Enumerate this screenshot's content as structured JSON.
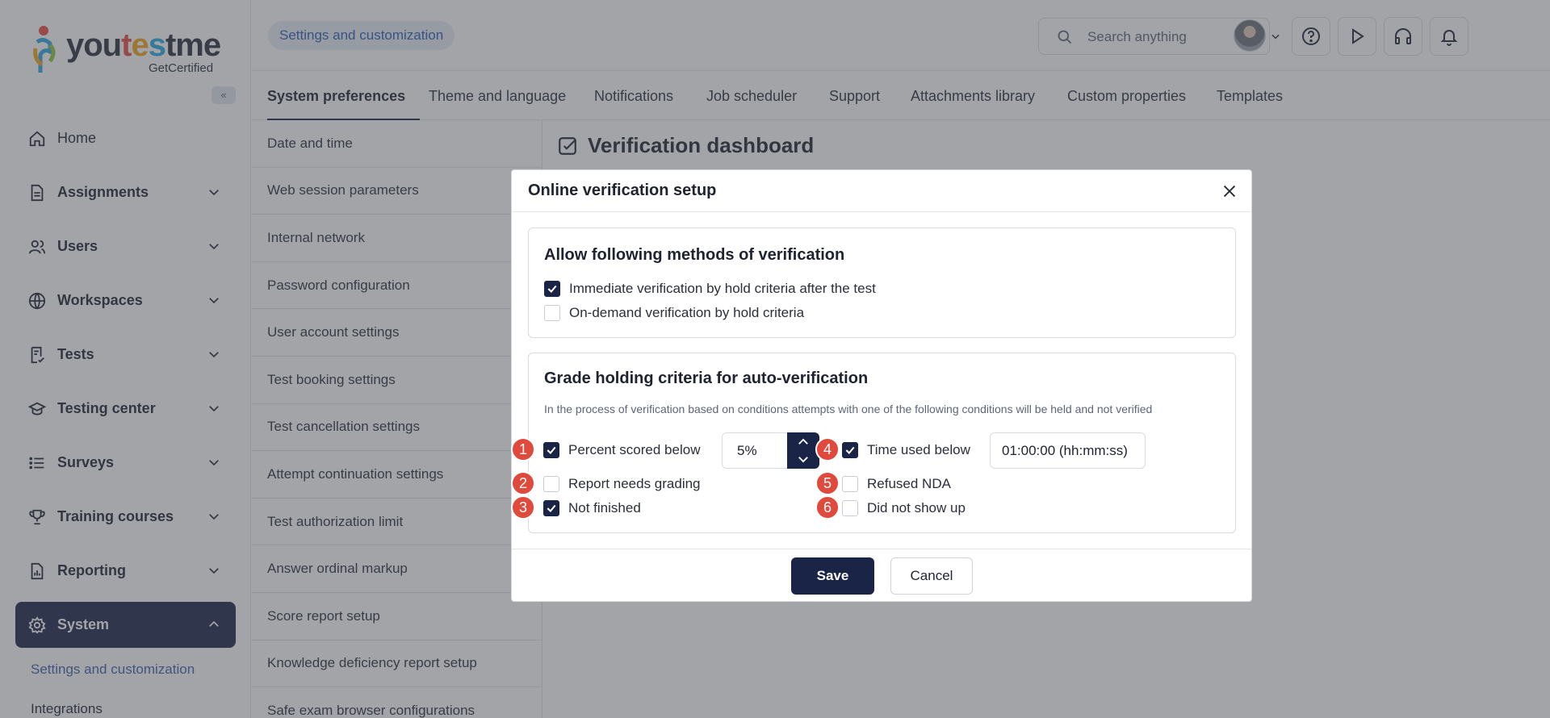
{
  "brand": {
    "logo_text_1": "you",
    "logo_e": "t",
    "logo_s": "e",
    "logo_t": "s",
    "logo_m": "tme",
    "sub": "GetCertified"
  },
  "sidebar": {
    "collapse_label": "«",
    "items": [
      {
        "label": "Home",
        "icon": "home-icon"
      },
      {
        "label": "Assignments",
        "icon": "document-icon"
      },
      {
        "label": "Users",
        "icon": "users-icon"
      },
      {
        "label": "Workspaces",
        "icon": "globe-icon"
      },
      {
        "label": "Tests",
        "icon": "test-icon"
      },
      {
        "label": "Testing center",
        "icon": "graduation-cap-icon"
      },
      {
        "label": "Surveys",
        "icon": "list-icon"
      },
      {
        "label": "Training courses",
        "icon": "trophy-icon"
      },
      {
        "label": "Reporting",
        "icon": "report-icon"
      },
      {
        "label": "System",
        "icon": "gear-icon"
      }
    ],
    "sub_current": "Settings and customization",
    "sub_next": "Integrations"
  },
  "topbar": {
    "breadcrumb": "Settings and customization",
    "search_placeholder": "Search anything"
  },
  "tabs": [
    "System preferences",
    "Theme and language",
    "Notifications",
    "Job scheduler",
    "Support",
    "Attachments library",
    "Custom properties",
    "Templates"
  ],
  "settings_list": [
    "Date and time",
    "Web session parameters",
    "Internal network",
    "Password configuration",
    "User account settings",
    "Test booking settings",
    "Test cancellation settings",
    "Attempt continuation settings",
    "Test authorization limit",
    "Answer ordinal markup",
    "Score report setup",
    "Knowledge deficiency report setup",
    "Safe exam browser configurations"
  ],
  "main": {
    "title": "Verification dashboard"
  },
  "modal": {
    "title": "Online verification setup",
    "section1": {
      "title": "Allow following methods of verification",
      "options": [
        {
          "label": "Immediate verification by hold criteria after the test",
          "checked": true
        },
        {
          "label": "On-demand verification by hold criteria",
          "checked": false
        }
      ]
    },
    "section2": {
      "title": "Grade holding criteria for auto-verification",
      "description": "In the process of verification based on conditions attempts with one of the following conditions will be held and not verified",
      "percent_label": "Percent scored below",
      "percent_value": "5%",
      "time_label": "Time used below",
      "time_value": "01:00:00 (hh:mm:ss)",
      "report_label": "Report needs grading",
      "nda_label": "Refused NDA",
      "not_finished_label": "Not finished",
      "no_show_label": "Did not show up",
      "badges": [
        "1",
        "2",
        "3",
        "4",
        "5",
        "6"
      ]
    },
    "save": "Save",
    "cancel": "Cancel"
  },
  "colors": {
    "primary": "#1a2447",
    "link": "#2e5bb3",
    "badge": "#e04a3c"
  }
}
